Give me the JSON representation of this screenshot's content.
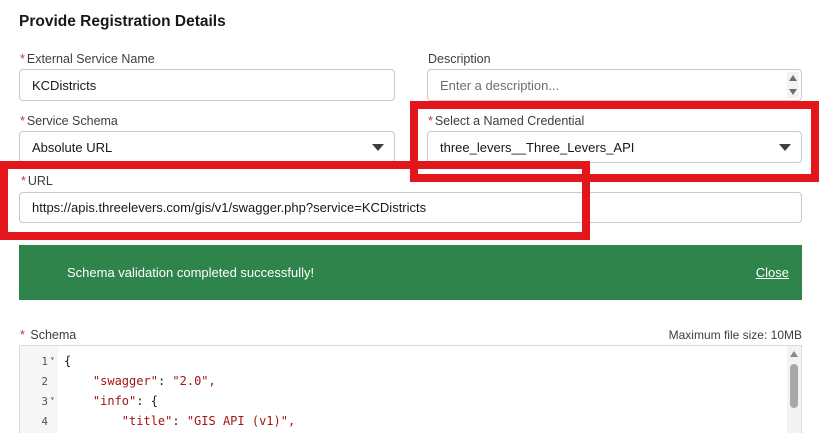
{
  "page": {
    "title": "Provide Registration Details"
  },
  "form": {
    "external_service_name": {
      "label": "External Service Name",
      "required_mark": "*",
      "value": "KCDistricts"
    },
    "description": {
      "label": "Description",
      "placeholder": "Enter a description..."
    },
    "service_schema": {
      "label": "Service Schema",
      "required_mark": "*",
      "value": "Absolute URL"
    },
    "named_credential": {
      "label": "Select a Named Credential",
      "required_mark": "*",
      "value": "three_levers__Three_Levers_API"
    },
    "url": {
      "label": "URL",
      "required_mark": "*",
      "value": "https://apis.threelevers.com/gis/v1/swagger.php?service=KCDistricts"
    }
  },
  "toast": {
    "message": "Schema validation completed successfully!",
    "close_label": "Close",
    "color": "#2e844a"
  },
  "schema": {
    "label": "Schema",
    "required_mark": "*",
    "max_size": "Maximum file size: 10MB",
    "lines": [
      {
        "num": "1",
        "key": "",
        "text": "{"
      },
      {
        "num": "2",
        "key": "\"swagger\"",
        "text": "\"2.0\","
      },
      {
        "num": "3",
        "key": "\"info\"",
        "text": "{"
      },
      {
        "num": "4",
        "key": "\"title\"",
        "text": "\"GIS API (v1)\","
      }
    ]
  },
  "colors": {
    "highlight": "#e3161c",
    "required": "#c23934"
  }
}
